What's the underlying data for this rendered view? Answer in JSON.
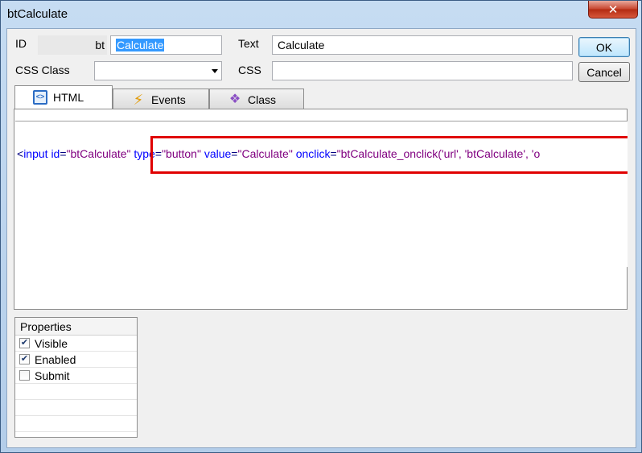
{
  "window": {
    "title": "btCalculate",
    "close_glyph": "✕"
  },
  "form": {
    "id_label": "ID",
    "id_prefix": "bt",
    "id_value": "Calculate",
    "text_label": "Text",
    "text_value": "Calculate",
    "css_class_label": "CSS Class",
    "css_class_value": "",
    "css_label": "CSS",
    "css_value": ""
  },
  "buttons": {
    "ok": "OK",
    "cancel": "Cancel"
  },
  "tabs": [
    {
      "label": "HTML",
      "icon": "html-code-icon",
      "active": true
    },
    {
      "label": "Events",
      "icon": "lightning-icon",
      "active": false
    },
    {
      "label": "Class",
      "icon": "class-icon",
      "active": false
    }
  ],
  "code": {
    "open": "<",
    "tag": "input",
    "attr_id": "id",
    "eq": "=",
    "val_id": "\"btCalculate\"",
    "attr_type": "type",
    "val_type": "\"button\"",
    "attr_value": "value",
    "val_value": "\"Calculate\"",
    "attr_onclick": "onclick",
    "val_onclick": "\"btCalculate_onclick('url', 'btCalculate', 'o"
  },
  "highlight_color": "#e00000",
  "scrollbar": {
    "left_glyph": "◀",
    "right_glyph": "▶",
    "grip": "|||"
  },
  "properties": {
    "header": "Properties",
    "items": [
      {
        "label": "Visible",
        "checked": true
      },
      {
        "label": "Enabled",
        "checked": true
      },
      {
        "label": "Submit",
        "checked": false
      }
    ]
  }
}
